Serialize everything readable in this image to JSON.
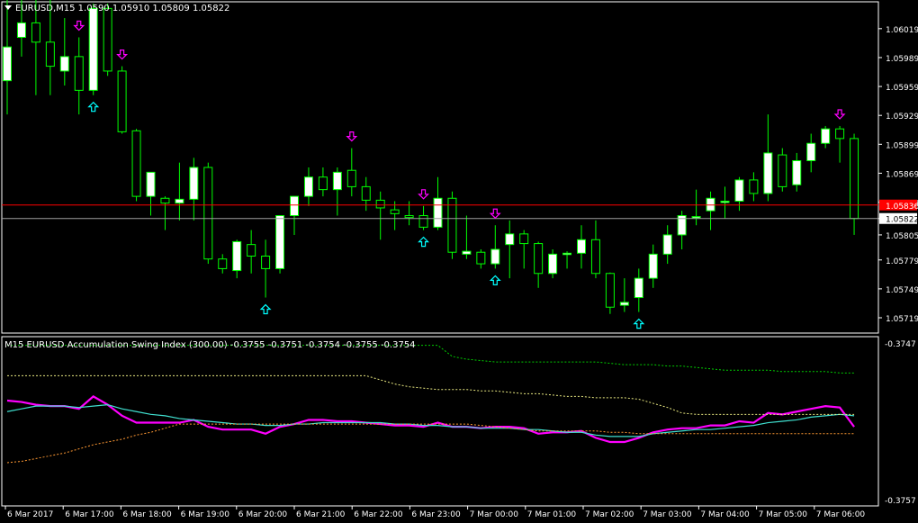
{
  "chart_data": [
    {
      "type": "candlestick",
      "symbol": "EURUSD",
      "timeframe": "M15",
      "title": "EURUSD,M15",
      "ohlc_header": [
        "1.0590",
        "1.05910",
        "1.05809",
        "1.05822"
      ],
      "price_ticks": [
        "1.06019",
        "1.05989",
        "1.05959",
        "1.05929",
        "1.05899",
        "1.05869",
        "1.05839",
        "1.05822",
        "1.05805",
        "1.05779",
        "1.05749",
        "1.05719"
      ],
      "ylim": [
        1.05705,
        1.06045
      ],
      "bid_line": 1.05822,
      "ask_line": 1.05836,
      "candles": [
        {
          "o": 1.05965,
          "h": 1.0605,
          "l": 1.0593,
          "c": 1.06
        },
        {
          "o": 1.0601,
          "h": 1.0605,
          "l": 1.0599,
          "c": 1.06025
        },
        {
          "o": 1.06025,
          "h": 1.0605,
          "l": 1.0595,
          "c": 1.06005
        },
        {
          "o": 1.06005,
          "h": 1.0605,
          "l": 1.0595,
          "c": 1.0598
        },
        {
          "o": 1.05975,
          "h": 1.0603,
          "l": 1.0596,
          "c": 1.0599
        },
        {
          "o": 1.0599,
          "h": 1.0601,
          "l": 1.0593,
          "c": 1.05955
        },
        {
          "o": 1.05955,
          "h": 1.06045,
          "l": 1.0595,
          "c": 1.0604
        },
        {
          "o": 1.0604,
          "h": 1.06045,
          "l": 1.0597,
          "c": 1.05975
        },
        {
          "o": 1.05975,
          "h": 1.0598,
          "l": 1.0591,
          "c": 1.05912
        },
        {
          "o": 1.05913,
          "h": 1.05915,
          "l": 1.0584,
          "c": 1.05845
        },
        {
          "o": 1.05845,
          "h": 1.0587,
          "l": 1.05825,
          "c": 1.0587
        },
        {
          "o": 1.05843,
          "h": 1.05845,
          "l": 1.0581,
          "c": 1.05838
        },
        {
          "o": 1.05838,
          "h": 1.0588,
          "l": 1.0582,
          "c": 1.05842
        },
        {
          "o": 1.05842,
          "h": 1.05885,
          "l": 1.0582,
          "c": 1.05875
        },
        {
          "o": 1.05875,
          "h": 1.0588,
          "l": 1.05775,
          "c": 1.0578
        },
        {
          "o": 1.0578,
          "h": 1.05785,
          "l": 1.05765,
          "c": 1.0577
        },
        {
          "o": 1.05768,
          "h": 1.058,
          "l": 1.0576,
          "c": 1.05798
        },
        {
          "o": 1.05795,
          "h": 1.0581,
          "l": 1.05765,
          "c": 1.05783
        },
        {
          "o": 1.05783,
          "h": 1.058,
          "l": 1.0574,
          "c": 1.0577
        },
        {
          "o": 1.0577,
          "h": 1.05825,
          "l": 1.05765,
          "c": 1.05825
        },
        {
          "o": 1.05825,
          "h": 1.05845,
          "l": 1.05805,
          "c": 1.05845
        },
        {
          "o": 1.05845,
          "h": 1.05875,
          "l": 1.05835,
          "c": 1.05865
        },
        {
          "o": 1.05865,
          "h": 1.05875,
          "l": 1.05845,
          "c": 1.05852
        },
        {
          "o": 1.05852,
          "h": 1.05875,
          "l": 1.05825,
          "c": 1.0587
        },
        {
          "o": 1.05872,
          "h": 1.05895,
          "l": 1.05845,
          "c": 1.05855
        },
        {
          "o": 1.05855,
          "h": 1.05865,
          "l": 1.0583,
          "c": 1.05841
        },
        {
          "o": 1.05841,
          "h": 1.0585,
          "l": 1.058,
          "c": 1.05833
        },
        {
          "o": 1.05831,
          "h": 1.0584,
          "l": 1.0581,
          "c": 1.05827
        },
        {
          "o": 1.05825,
          "h": 1.0584,
          "l": 1.05815,
          "c": 1.05823
        },
        {
          "o": 1.05825,
          "h": 1.05835,
          "l": 1.0581,
          "c": 1.05813
        },
        {
          "o": 1.05813,
          "h": 1.05865,
          "l": 1.0581,
          "c": 1.05843
        },
        {
          "o": 1.05843,
          "h": 1.0585,
          "l": 1.0578,
          "c": 1.05787
        },
        {
          "o": 1.05785,
          "h": 1.05825,
          "l": 1.0578,
          "c": 1.05788
        },
        {
          "o": 1.05787,
          "h": 1.0579,
          "l": 1.0577,
          "c": 1.05775
        },
        {
          "o": 1.05775,
          "h": 1.05815,
          "l": 1.0577,
          "c": 1.0579
        },
        {
          "o": 1.05795,
          "h": 1.0582,
          "l": 1.0576,
          "c": 1.05806
        },
        {
          "o": 1.05806,
          "h": 1.0581,
          "l": 1.0577,
          "c": 1.05796
        },
        {
          "o": 1.05796,
          "h": 1.05798,
          "l": 1.0575,
          "c": 1.05765
        },
        {
          "o": 1.05765,
          "h": 1.0579,
          "l": 1.0576,
          "c": 1.05785
        },
        {
          "o": 1.05785,
          "h": 1.05788,
          "l": 1.0577,
          "c": 1.05786
        },
        {
          "o": 1.05786,
          "h": 1.05815,
          "l": 1.0577,
          "c": 1.058
        },
        {
          "o": 1.058,
          "h": 1.0582,
          "l": 1.0576,
          "c": 1.05765
        },
        {
          "o": 1.05765,
          "h": 1.05766,
          "l": 1.05723,
          "c": 1.0573
        },
        {
          "o": 1.05732,
          "h": 1.0576,
          "l": 1.05725,
          "c": 1.05735
        },
        {
          "o": 1.0574,
          "h": 1.0577,
          "l": 1.05725,
          "c": 1.0576
        },
        {
          "o": 1.0576,
          "h": 1.05795,
          "l": 1.0575,
          "c": 1.05785
        },
        {
          "o": 1.05785,
          "h": 1.05815,
          "l": 1.05775,
          "c": 1.05805
        },
        {
          "o": 1.05805,
          "h": 1.0583,
          "l": 1.0579,
          "c": 1.05825
        },
        {
          "o": 1.05823,
          "h": 1.05852,
          "l": 1.05815,
          "c": 1.05824
        },
        {
          "o": 1.0583,
          "h": 1.0585,
          "l": 1.0581,
          "c": 1.05843
        },
        {
          "o": 1.0584,
          "h": 1.05855,
          "l": 1.05822,
          "c": 1.0584
        },
        {
          "o": 1.0584,
          "h": 1.05865,
          "l": 1.0583,
          "c": 1.05862
        },
        {
          "o": 1.05862,
          "h": 1.0587,
          "l": 1.0584,
          "c": 1.05848
        },
        {
          "o": 1.05848,
          "h": 1.0593,
          "l": 1.0584,
          "c": 1.0589
        },
        {
          "o": 1.05888,
          "h": 1.05895,
          "l": 1.0585,
          "c": 1.05855
        },
        {
          "o": 1.05857,
          "h": 1.0589,
          "l": 1.0585,
          "c": 1.05882
        },
        {
          "o": 1.05882,
          "h": 1.0591,
          "l": 1.0587,
          "c": 1.059
        },
        {
          "o": 1.059,
          "h": 1.05918,
          "l": 1.05895,
          "c": 1.05915
        },
        {
          "o": 1.05915,
          "h": 1.05918,
          "l": 1.0588,
          "c": 1.05905
        },
        {
          "o": 1.05905,
          "h": 1.0591,
          "l": 1.05805,
          "c": 1.05822
        }
      ],
      "down_arrows": [
        5,
        8,
        24,
        29,
        34,
        58
      ],
      "up_arrows": [
        6,
        18,
        29,
        34,
        44
      ]
    },
    {
      "type": "line",
      "title": "M15 EURUSD Accumulation Swing Index (300.00) -0.3755 -0.3751 -0.3754 -0.3755 -0.3754",
      "value_ticks": [
        "-0.3747",
        "-0.3757"
      ],
      "ylim": [
        -0.3758,
        -0.3746
      ],
      "series": [
        {
          "color": "#ff00ff",
          "values": [
            -0.37505,
            -0.37506,
            -0.37508,
            -0.37509,
            -0.37509,
            -0.37511,
            -0.37502,
            -0.37508,
            -0.37516,
            -0.37521,
            -0.37521,
            -0.37521,
            -0.37521,
            -0.37519,
            -0.37524,
            -0.37526,
            -0.37526,
            -0.37526,
            -0.37529,
            -0.37524,
            -0.37522,
            -0.37519,
            -0.37519,
            -0.3752,
            -0.3752,
            -0.37521,
            -0.37522,
            -0.37523,
            -0.37523,
            -0.37524,
            -0.37521,
            -0.37524,
            -0.37524,
            -0.37525,
            -0.37524,
            -0.37524,
            -0.37525,
            -0.37529,
            -0.37528,
            -0.37528,
            -0.37527,
            -0.37532,
            -0.37535,
            -0.37535,
            -0.37532,
            -0.37528,
            -0.37526,
            -0.37525,
            -0.37525,
            -0.37523,
            -0.37523,
            -0.3752,
            -0.37521,
            -0.37514,
            -0.37515,
            -0.37513,
            -0.37511,
            -0.37509,
            -0.3751,
            -0.37524
          ]
        },
        {
          "color": "#40e0d0",
          "values": [
            -0.37513,
            -0.37511,
            -0.37509,
            -0.37509,
            -0.37509,
            -0.3751,
            -0.37509,
            -0.37508,
            -0.37511,
            -0.37513,
            -0.37515,
            -0.37516,
            -0.37518,
            -0.37519,
            -0.3752,
            -0.37521,
            -0.37522,
            -0.37522,
            -0.37523,
            -0.37523,
            -0.37522,
            -0.37522,
            -0.37521,
            -0.37521,
            -0.37521,
            -0.37521,
            -0.37521,
            -0.37522,
            -0.37522,
            -0.37523,
            -0.37523,
            -0.37524,
            -0.37524,
            -0.37525,
            -0.37525,
            -0.37525,
            -0.37526,
            -0.37526,
            -0.37527,
            -0.37528,
            -0.37528,
            -0.3753,
            -0.37531,
            -0.37531,
            -0.37531,
            -0.37529,
            -0.37528,
            -0.37527,
            -0.37526,
            -0.37526,
            -0.37525,
            -0.37524,
            -0.37523,
            -0.37521,
            -0.3752,
            -0.37519,
            -0.37517,
            -0.37516,
            -0.37515,
            -0.37516
          ]
        },
        {
          "color": "#00cc00",
          "dashed": true,
          "values": [
            -0.37465,
            -0.37465,
            -0.37465,
            -0.37465,
            -0.37465,
            -0.37465,
            -0.37465,
            -0.37465,
            -0.37465,
            -0.37465,
            -0.37465,
            -0.37465,
            -0.37465,
            -0.37465,
            -0.37465,
            -0.37465,
            -0.37465,
            -0.37465,
            -0.37465,
            -0.37465,
            -0.37465,
            -0.37465,
            -0.37465,
            -0.37465,
            -0.37465,
            -0.37465,
            -0.37465,
            -0.37465,
            -0.37465,
            -0.37465,
            -0.37465,
            -0.37473,
            -0.37475,
            -0.37476,
            -0.37477,
            -0.37477,
            -0.37477,
            -0.37477,
            -0.37477,
            -0.37477,
            -0.37477,
            -0.37477,
            -0.37478,
            -0.37479,
            -0.37479,
            -0.37479,
            -0.3748,
            -0.3748,
            -0.37481,
            -0.37482,
            -0.37483,
            -0.37483,
            -0.37483,
            -0.37483,
            -0.37484,
            -0.37484,
            -0.37484,
            -0.37484,
            -0.37485,
            -0.37485
          ]
        },
        {
          "color": "#e8e880",
          "dashed": true,
          "values": [
            -0.37487,
            -0.37487,
            -0.37487,
            -0.37487,
            -0.37487,
            -0.37487,
            -0.37487,
            -0.37487,
            -0.37487,
            -0.37487,
            -0.37487,
            -0.37487,
            -0.37487,
            -0.37487,
            -0.37487,
            -0.37487,
            -0.37487,
            -0.37487,
            -0.37487,
            -0.37487,
            -0.37487,
            -0.37487,
            -0.37487,
            -0.37487,
            -0.37487,
            -0.37487,
            -0.3749,
            -0.37493,
            -0.37495,
            -0.37496,
            -0.37497,
            -0.37497,
            -0.37497,
            -0.37498,
            -0.37498,
            -0.37499,
            -0.375,
            -0.375,
            -0.37501,
            -0.37502,
            -0.37502,
            -0.37503,
            -0.37503,
            -0.37503,
            -0.37504,
            -0.37507,
            -0.3751,
            -0.37514,
            -0.37515,
            -0.37515,
            -0.37515,
            -0.37515,
            -0.37515,
            -0.37515,
            -0.37515,
            -0.37515,
            -0.37515,
            -0.37515,
            -0.37515,
            -0.37515
          ]
        },
        {
          "color": "#ff9933",
          "dashed": true,
          "values": [
            -0.3755,
            -0.37549,
            -0.37547,
            -0.37545,
            -0.37543,
            -0.3754,
            -0.37537,
            -0.37535,
            -0.37533,
            -0.3753,
            -0.37528,
            -0.37525,
            -0.37522,
            -0.37522,
            -0.37522,
            -0.37522,
            -0.37522,
            -0.37522,
            -0.37522,
            -0.37522,
            -0.37522,
            -0.37522,
            -0.37522,
            -0.37522,
            -0.37522,
            -0.37522,
            -0.37522,
            -0.37522,
            -0.37522,
            -0.37522,
            -0.37522,
            -0.37522,
            -0.37522,
            -0.37523,
            -0.37524,
            -0.37525,
            -0.37526,
            -0.37527,
            -0.37527,
            -0.37527,
            -0.37527,
            -0.37527,
            -0.37528,
            -0.37528,
            -0.37529,
            -0.37529,
            -0.37529,
            -0.37529,
            -0.37529,
            -0.37529,
            -0.37529,
            -0.37529,
            -0.37529,
            -0.37529,
            -0.37529,
            -0.37529,
            -0.37529,
            -0.37529,
            -0.37529,
            -0.37529
          ]
        }
      ]
    }
  ],
  "time_labels": [
    "6 Mar 2017",
    "6 Mar 17:00",
    "6 Mar 18:00",
    "6 Mar 19:00",
    "6 Mar 20:00",
    "6 Mar 21:00",
    "6 Mar 22:00",
    "6 Mar 23:00",
    "7 Mar 00:00",
    "7 Mar 01:00",
    "7 Mar 02:00",
    "7 Mar 03:00",
    "7 Mar 04:00",
    "7 Mar 05:00",
    "7 Mar 06:00"
  ],
  "colors": {
    "background": "#000000",
    "grid_frame": "#ffffff",
    "bull_fill": "#ffffff",
    "bear_fill": "#000000",
    "wick": "#00ff00",
    "bid_line": "#a0a0a0",
    "ask_line": "#ff0000",
    "down_arrow": "#ff00ff",
    "up_arrow": "#00ffff"
  },
  "icons": {
    "title_menu": "triangle-down-icon",
    "down_signal": "arrow-down-icon",
    "up_signal": "arrow-up-icon"
  }
}
